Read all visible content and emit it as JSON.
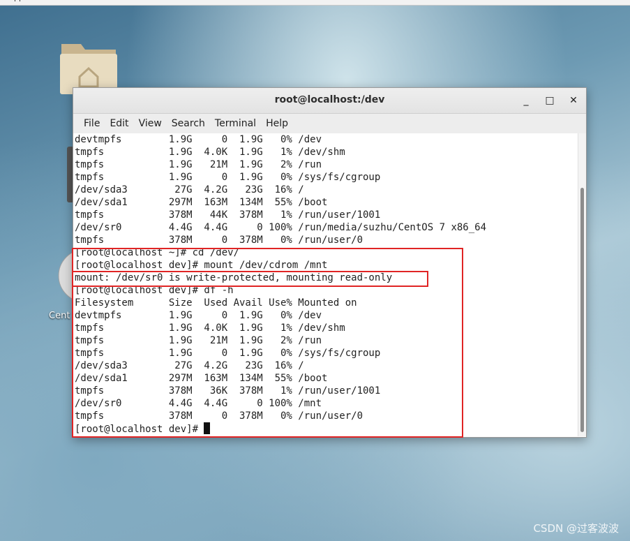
{
  "colors": {
    "highlight": "#e02424",
    "terminal_bg": "#ffffff",
    "terminal_fg": "#222222"
  },
  "topbar": {
    "label": "pp"
  },
  "desktop": {
    "home_icon": "home-folder-icon",
    "disc_icon": "optical-disc-icon",
    "disc_label": "Cent"
  },
  "window": {
    "title": "root@localhost:/dev",
    "controls": {
      "minimize": "_",
      "maximize": "□",
      "close": "✕"
    }
  },
  "menu": [
    "File",
    "Edit",
    "View",
    "Search",
    "Terminal",
    "Help"
  ],
  "terminal": {
    "lines": [
      "devtmpfs        1.9G     0  1.9G   0% /dev",
      "tmpfs           1.9G  4.0K  1.9G   1% /dev/shm",
      "tmpfs           1.9G   21M  1.9G   2% /run",
      "tmpfs           1.9G     0  1.9G   0% /sys/fs/cgroup",
      "/dev/sda3        27G  4.2G   23G  16% /",
      "/dev/sda1       297M  163M  134M  55% /boot",
      "tmpfs           378M   44K  378M   1% /run/user/1001",
      "/dev/sr0        4.4G  4.4G     0 100% /run/media/suzhu/CentOS 7 x86_64",
      "tmpfs           378M     0  378M   0% /run/user/0",
      "[root@localhost ~]# cd /dev/",
      "[root@localhost dev]# mount /dev/cdrom /mnt",
      "mount: /dev/sr0 is write-protected, mounting read-only",
      "[root@localhost dev]# df -h",
      "Filesystem      Size  Used Avail Use% Mounted on",
      "devtmpfs        1.9G     0  1.9G   0% /dev",
      "tmpfs           1.9G  4.0K  1.9G   1% /dev/shm",
      "tmpfs           1.9G   21M  1.9G   2% /run",
      "tmpfs           1.9G     0  1.9G   0% /sys/fs/cgroup",
      "/dev/sda3        27G  4.2G   23G  16% /",
      "/dev/sda1       297M  163M  134M  55% /boot",
      "tmpfs           378M   36K  378M   1% /run/user/1001",
      "/dev/sr0        4.4G  4.4G     0 100% /mnt",
      "tmpfs           378M     0  378M   0% /run/user/0"
    ],
    "prompt": "[root@localhost dev]# "
  },
  "watermark": "CSDN @过客波波"
}
